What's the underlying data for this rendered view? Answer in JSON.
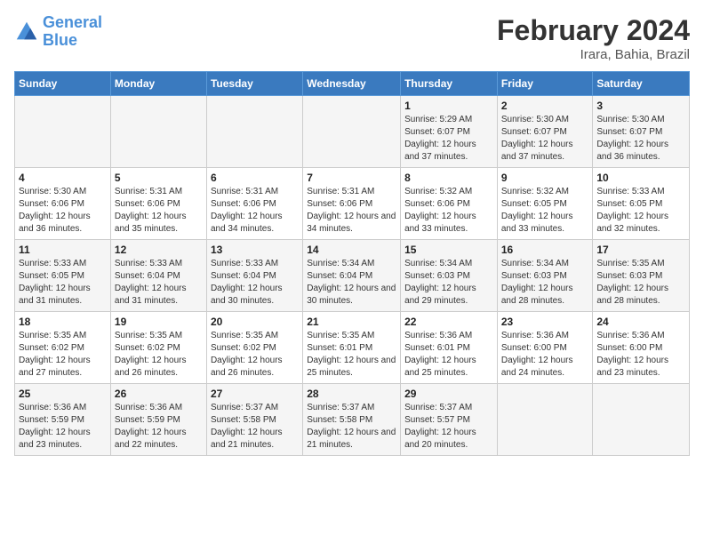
{
  "header": {
    "logo_general": "General",
    "logo_blue": "Blue",
    "main_title": "February 2024",
    "sub_title": "Irara, Bahia, Brazil"
  },
  "days_of_week": [
    "Sunday",
    "Monday",
    "Tuesday",
    "Wednesday",
    "Thursday",
    "Friday",
    "Saturday"
  ],
  "weeks": [
    [
      {
        "num": "",
        "detail": ""
      },
      {
        "num": "",
        "detail": ""
      },
      {
        "num": "",
        "detail": ""
      },
      {
        "num": "",
        "detail": ""
      },
      {
        "num": "1",
        "detail": "Sunrise: 5:29 AM\nSunset: 6:07 PM\nDaylight: 12 hours and 37 minutes."
      },
      {
        "num": "2",
        "detail": "Sunrise: 5:30 AM\nSunset: 6:07 PM\nDaylight: 12 hours and 37 minutes."
      },
      {
        "num": "3",
        "detail": "Sunrise: 5:30 AM\nSunset: 6:07 PM\nDaylight: 12 hours and 36 minutes."
      }
    ],
    [
      {
        "num": "4",
        "detail": "Sunrise: 5:30 AM\nSunset: 6:06 PM\nDaylight: 12 hours and 36 minutes."
      },
      {
        "num": "5",
        "detail": "Sunrise: 5:31 AM\nSunset: 6:06 PM\nDaylight: 12 hours and 35 minutes."
      },
      {
        "num": "6",
        "detail": "Sunrise: 5:31 AM\nSunset: 6:06 PM\nDaylight: 12 hours and 34 minutes."
      },
      {
        "num": "7",
        "detail": "Sunrise: 5:31 AM\nSunset: 6:06 PM\nDaylight: 12 hours and 34 minutes."
      },
      {
        "num": "8",
        "detail": "Sunrise: 5:32 AM\nSunset: 6:06 PM\nDaylight: 12 hours and 33 minutes."
      },
      {
        "num": "9",
        "detail": "Sunrise: 5:32 AM\nSunset: 6:05 PM\nDaylight: 12 hours and 33 minutes."
      },
      {
        "num": "10",
        "detail": "Sunrise: 5:33 AM\nSunset: 6:05 PM\nDaylight: 12 hours and 32 minutes."
      }
    ],
    [
      {
        "num": "11",
        "detail": "Sunrise: 5:33 AM\nSunset: 6:05 PM\nDaylight: 12 hours and 31 minutes."
      },
      {
        "num": "12",
        "detail": "Sunrise: 5:33 AM\nSunset: 6:04 PM\nDaylight: 12 hours and 31 minutes."
      },
      {
        "num": "13",
        "detail": "Sunrise: 5:33 AM\nSunset: 6:04 PM\nDaylight: 12 hours and 30 minutes."
      },
      {
        "num": "14",
        "detail": "Sunrise: 5:34 AM\nSunset: 6:04 PM\nDaylight: 12 hours and 30 minutes."
      },
      {
        "num": "15",
        "detail": "Sunrise: 5:34 AM\nSunset: 6:03 PM\nDaylight: 12 hours and 29 minutes."
      },
      {
        "num": "16",
        "detail": "Sunrise: 5:34 AM\nSunset: 6:03 PM\nDaylight: 12 hours and 28 minutes."
      },
      {
        "num": "17",
        "detail": "Sunrise: 5:35 AM\nSunset: 6:03 PM\nDaylight: 12 hours and 28 minutes."
      }
    ],
    [
      {
        "num": "18",
        "detail": "Sunrise: 5:35 AM\nSunset: 6:02 PM\nDaylight: 12 hours and 27 minutes."
      },
      {
        "num": "19",
        "detail": "Sunrise: 5:35 AM\nSunset: 6:02 PM\nDaylight: 12 hours and 26 minutes."
      },
      {
        "num": "20",
        "detail": "Sunrise: 5:35 AM\nSunset: 6:02 PM\nDaylight: 12 hours and 26 minutes."
      },
      {
        "num": "21",
        "detail": "Sunrise: 5:35 AM\nSunset: 6:01 PM\nDaylight: 12 hours and 25 minutes."
      },
      {
        "num": "22",
        "detail": "Sunrise: 5:36 AM\nSunset: 6:01 PM\nDaylight: 12 hours and 25 minutes."
      },
      {
        "num": "23",
        "detail": "Sunrise: 5:36 AM\nSunset: 6:00 PM\nDaylight: 12 hours and 24 minutes."
      },
      {
        "num": "24",
        "detail": "Sunrise: 5:36 AM\nSunset: 6:00 PM\nDaylight: 12 hours and 23 minutes."
      }
    ],
    [
      {
        "num": "25",
        "detail": "Sunrise: 5:36 AM\nSunset: 5:59 PM\nDaylight: 12 hours and 23 minutes."
      },
      {
        "num": "26",
        "detail": "Sunrise: 5:36 AM\nSunset: 5:59 PM\nDaylight: 12 hours and 22 minutes."
      },
      {
        "num": "27",
        "detail": "Sunrise: 5:37 AM\nSunset: 5:58 PM\nDaylight: 12 hours and 21 minutes."
      },
      {
        "num": "28",
        "detail": "Sunrise: 5:37 AM\nSunset: 5:58 PM\nDaylight: 12 hours and 21 minutes."
      },
      {
        "num": "29",
        "detail": "Sunrise: 5:37 AM\nSunset: 5:57 PM\nDaylight: 12 hours and 20 minutes."
      },
      {
        "num": "",
        "detail": ""
      },
      {
        "num": "",
        "detail": ""
      }
    ]
  ]
}
